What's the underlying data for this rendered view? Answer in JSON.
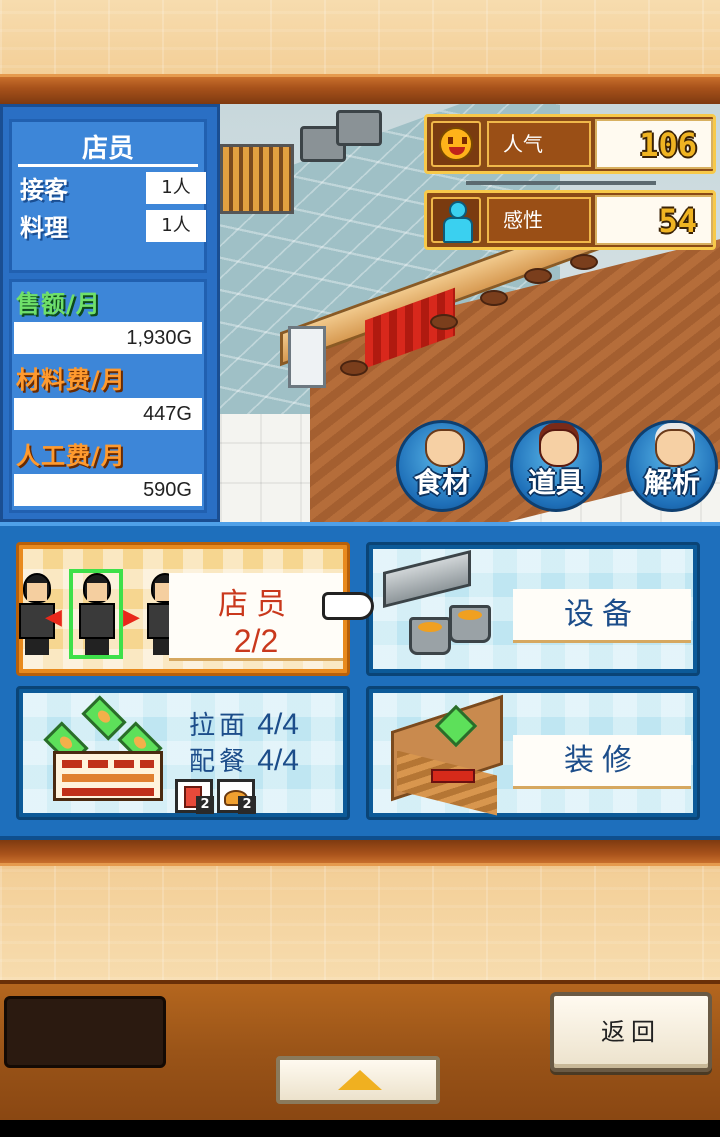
{
  "staff_panel": {
    "title": "店员",
    "rows": [
      {
        "label": "接客",
        "value": "1人"
      },
      {
        "label": "料理",
        "value": "1人"
      }
    ]
  },
  "finance_panel": {
    "sales_label": "售额/月",
    "sales_value": "1,930G",
    "material_label": "材料费/月",
    "material_value": "447G",
    "labor_label": "人工费/月",
    "labor_value": "590G"
  },
  "stats": {
    "popularity": {
      "label": "人气",
      "value": "106",
      "icon": "smile-face-icon"
    },
    "sense": {
      "label": "感性",
      "value": "54",
      "icon": "person-icon"
    }
  },
  "round_buttons": [
    {
      "label": "食材",
      "icon": "glasses-man-icon"
    },
    {
      "label": "道具",
      "icon": "girl-icon"
    },
    {
      "label": "解析",
      "icon": "old-man-icon"
    }
  ],
  "menu_cards": {
    "staff": {
      "title": "店员",
      "count": "2/2"
    },
    "equipment": {
      "title": "设备"
    },
    "menu": {
      "ramen_label": "拉面",
      "ramen_count": "4/4",
      "side_label": "配餐",
      "side_count": "4/4",
      "badge1_num": "2",
      "badge2_num": "2"
    },
    "decor": {
      "title": "装修"
    }
  },
  "controls": {
    "back_label": "返回",
    "up_icon": "up-arrow-icon"
  },
  "colors": {
    "panel_blue": "#2a6fc4",
    "accent_orange": "#e88a1e",
    "highlight_green": "#3ee04a",
    "value_gold": "#f0b422"
  }
}
